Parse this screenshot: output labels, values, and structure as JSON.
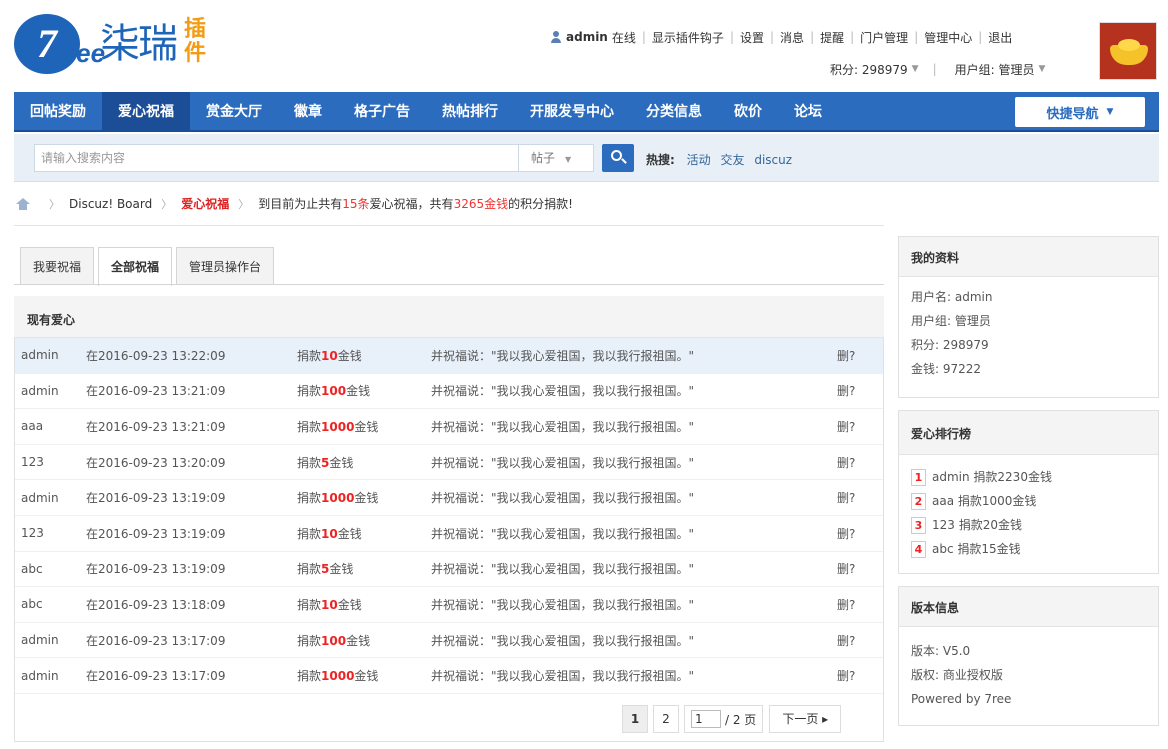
{
  "logo": {
    "seven": "7",
    "ree": "ree",
    "name": "柒瑞",
    "plugin": "插件"
  },
  "topnav": {
    "user": "admin",
    "online": "在线",
    "links": [
      "显示插件钩子",
      "设置",
      "消息",
      "提醒",
      "门户管理",
      "管理中心",
      "退出"
    ],
    "points_label": "积分: 298979",
    "group_label": "用户组: 管理员"
  },
  "nav": {
    "items": [
      "回帖奖励",
      "爱心祝福",
      "赏金大厅",
      "徽章",
      "格子广告",
      "热帖排行",
      "开服发号中心",
      "分类信息",
      "砍价",
      "论坛"
    ],
    "active_index": 1,
    "quick": "快捷导航"
  },
  "search": {
    "placeholder": "请输入搜索内容",
    "type": "帖子",
    "hot_label": "热搜:",
    "hot": [
      "活动",
      "交友",
      "discuz"
    ]
  },
  "breadcrumb": {
    "board": "Discuz! Board",
    "current": "爱心祝福",
    "text_pre": "到目前为止共有",
    "count": "15条",
    "text_mid": "爱心祝福，共有",
    "amount": "3265金钱",
    "text_post": "的积分捐款!"
  },
  "tabs": [
    "我要祝福",
    "全部祝福",
    "管理员操作台"
  ],
  "list": {
    "title": "现有爱心",
    "rows": [
      {
        "user": "admin",
        "time": "在2016-09-23 13:22:09",
        "pre": "捐款",
        "amt": "10",
        "unit": "金钱",
        "msg": "并祝福说：\"我以我心爱祖国，我以我行报祖国。\"",
        "del": "删?"
      },
      {
        "user": "admin",
        "time": "在2016-09-23 13:21:09",
        "pre": "捐款",
        "amt": "100",
        "unit": "金钱",
        "msg": "并祝福说：\"我以我心爱祖国，我以我行报祖国。\"",
        "del": "删?"
      },
      {
        "user": "aaa",
        "time": "在2016-09-23 13:21:09",
        "pre": "捐款",
        "amt": "1000",
        "unit": "金钱",
        "msg": "并祝福说：\"我以我心爱祖国，我以我行报祖国。\"",
        "del": "删?"
      },
      {
        "user": "123",
        "time": "在2016-09-23 13:20:09",
        "pre": "捐款",
        "amt": "5",
        "unit": "金钱",
        "msg": "并祝福说：\"我以我心爱祖国，我以我行报祖国。\"",
        "del": "删?"
      },
      {
        "user": "admin",
        "time": "在2016-09-23 13:19:09",
        "pre": "捐款",
        "amt": "1000",
        "unit": "金钱",
        "msg": "并祝福说：\"我以我心爱祖国，我以我行报祖国。\"",
        "del": "删?"
      },
      {
        "user": "123",
        "time": "在2016-09-23 13:19:09",
        "pre": "捐款",
        "amt": "10",
        "unit": "金钱",
        "msg": "并祝福说：\"我以我心爱祖国，我以我行报祖国。\"",
        "del": "删?"
      },
      {
        "user": "abc",
        "time": "在2016-09-23 13:19:09",
        "pre": "捐款",
        "amt": "5",
        "unit": "金钱",
        "msg": "并祝福说：\"我以我心爱祖国，我以我行报祖国。\"",
        "del": "删?"
      },
      {
        "user": "abc",
        "time": "在2016-09-23 13:18:09",
        "pre": "捐款",
        "amt": "10",
        "unit": "金钱",
        "msg": "并祝福说：\"我以我心爱祖国，我以我行报祖国。\"",
        "del": "删?"
      },
      {
        "user": "admin",
        "time": "在2016-09-23 13:17:09",
        "pre": "捐款",
        "amt": "100",
        "unit": "金钱",
        "msg": "并祝福说：\"我以我心爱祖国，我以我行报祖国。\"",
        "del": "删?"
      },
      {
        "user": "admin",
        "time": "在2016-09-23 13:17:09",
        "pre": "捐款",
        "amt": "1000",
        "unit": "金钱",
        "msg": "并祝福说：\"我以我心爱祖国，我以我行报祖国。\"",
        "del": "删?"
      }
    ]
  },
  "pager": {
    "pages": [
      "1",
      "2"
    ],
    "current": "1",
    "input": "1",
    "total": "/ 2 页",
    "next": "下一页 ▸"
  },
  "profile": {
    "title": "我的资料",
    "lines": [
      "用户名: admin",
      "用户组: 管理员",
      "积分: 298979",
      "金钱: 97222"
    ]
  },
  "ranking": {
    "title": "爱心排行榜",
    "items": [
      {
        "n": "1",
        "text": "admin 捐款2230金钱"
      },
      {
        "n": "2",
        "text": "aaa 捐款1000金钱"
      },
      {
        "n": "3",
        "text": "123 捐款20金钱"
      },
      {
        "n": "4",
        "text": "abc 捐款15金钱"
      }
    ]
  },
  "version": {
    "title": "版本信息",
    "lines": [
      "版本: V5.0",
      "版权: 商业授权版",
      "Powered by 7ree"
    ]
  },
  "colors": {
    "primary": "#2b6cbf",
    "primary_dark": "#1b4e96",
    "accent_red": "#e22",
    "logo_orange": "#f39b13"
  }
}
